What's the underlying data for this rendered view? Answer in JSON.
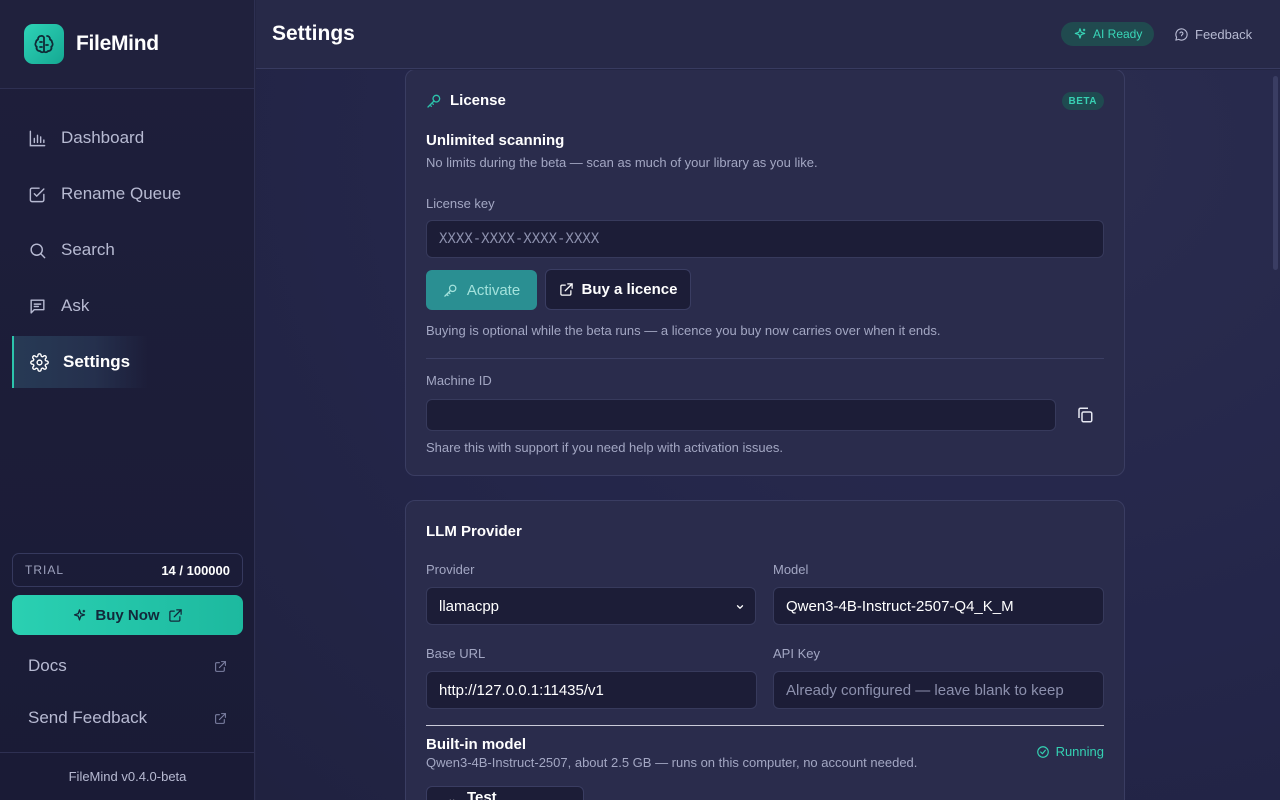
{
  "app": {
    "name": "FileMind",
    "version": "FileMind v0.4.0-beta"
  },
  "sidebar": {
    "items": [
      {
        "label": "Dashboard",
        "icon": "bar-chart-icon"
      },
      {
        "label": "Rename Queue",
        "icon": "check-square-icon"
      },
      {
        "label": "Search",
        "icon": "search-icon"
      },
      {
        "label": "Ask",
        "icon": "message-icon"
      },
      {
        "label": "Settings",
        "icon": "gear-icon",
        "active": true
      }
    ],
    "trial": {
      "label": "TRIAL",
      "count": "14 / 100000"
    },
    "buy_now": "Buy Now",
    "docs": "Docs",
    "send_feedback": "Send Feedback"
  },
  "header": {
    "title": "Settings",
    "ai_status": "AI Ready",
    "feedback": "Feedback"
  },
  "license": {
    "title": "License",
    "badge": "BETA",
    "plan_title": "Unlimited scanning",
    "plan_desc": "No limits during the beta — scan as much of your library as you like.",
    "key_label": "License key",
    "key_placeholder": "XXXX-XXXX-XXXX-XXXX",
    "activate": "Activate",
    "buy": "Buy a licence",
    "buy_note": "Buying is optional while the beta runs — a licence you buy now carries over when it ends.",
    "machine_label": "Machine ID",
    "machine_value": "",
    "machine_note": "Share this with support if you need help with activation issues."
  },
  "llm": {
    "title": "LLM Provider",
    "provider_label": "Provider",
    "provider_value": "llamacpp",
    "model_label": "Model",
    "model_value": "Qwen3-4B-Instruct-2507-Q4_K_M",
    "base_url_label": "Base URL",
    "base_url_value": "http://127.0.0.1:11435/v1",
    "api_key_label": "API Key",
    "api_key_placeholder": "Already configured — leave blank to keep",
    "builtin_title": "Built-in model",
    "builtin_desc": "Qwen3-4B-Instruct-2507, about 2.5 GB — runs on this computer, no account needed.",
    "builtin_status": "Running",
    "test_button": "Test Connection"
  },
  "colors": {
    "accent": "#2cc4ac",
    "background": "#232543",
    "sidebar": "#1e1f3b"
  }
}
